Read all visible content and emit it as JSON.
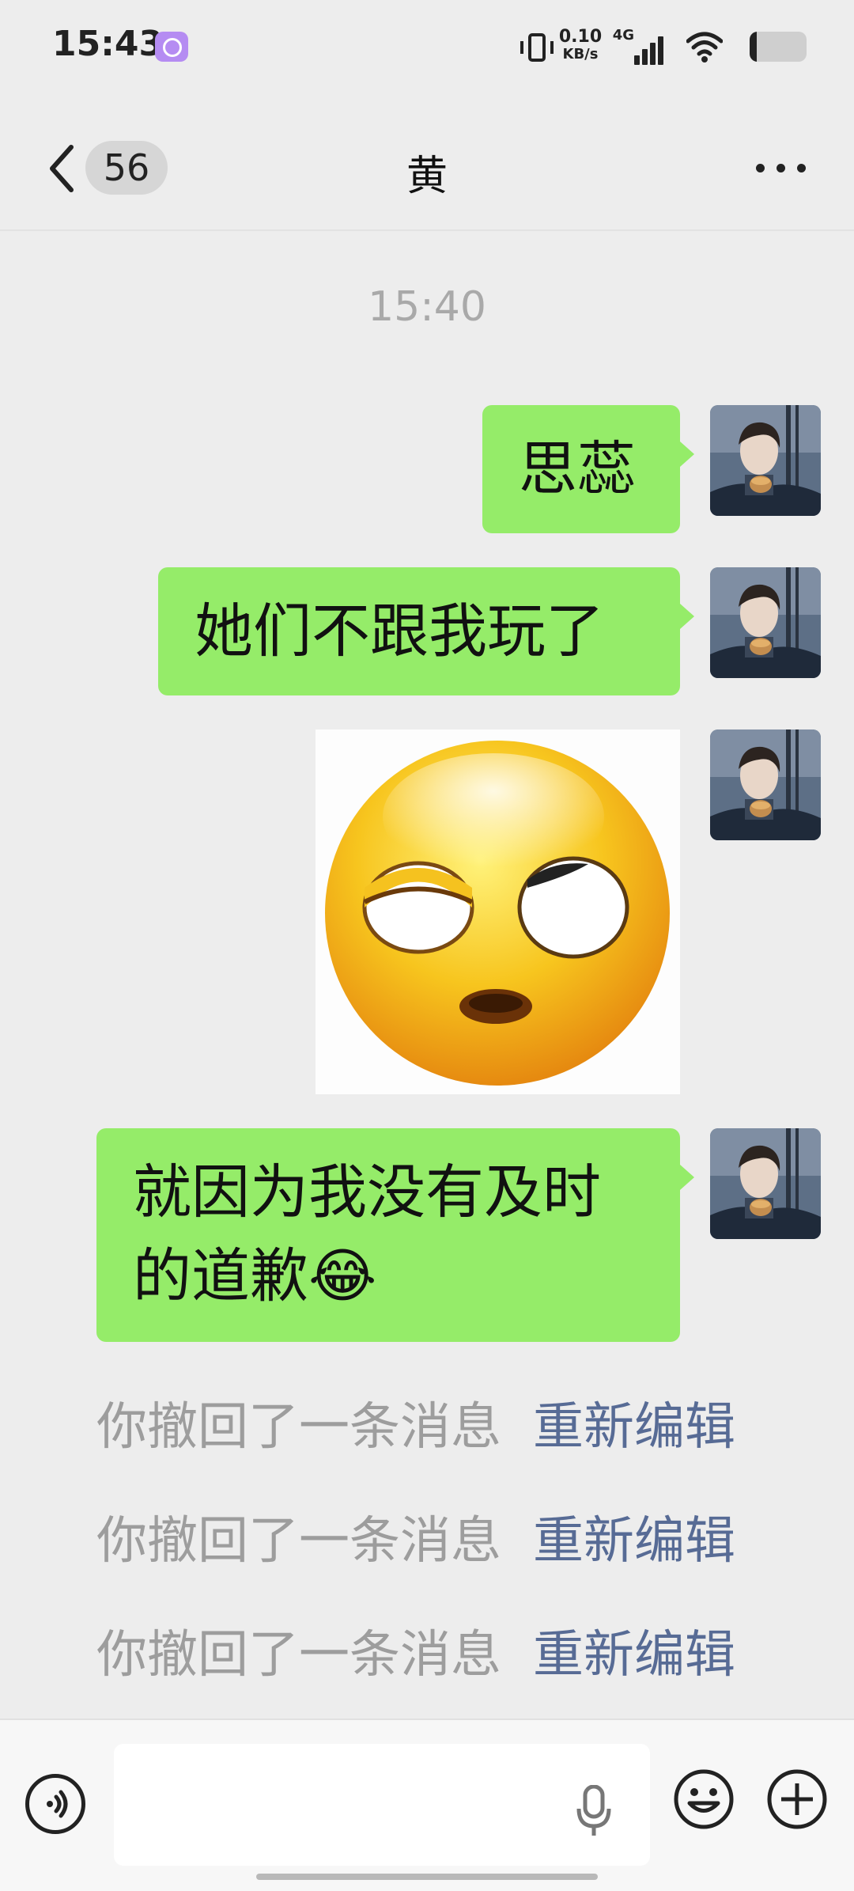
{
  "status_bar": {
    "time": "15:43",
    "net_speed_value": "0.10",
    "net_speed_unit": "KB/s",
    "network_type": "4G",
    "battery_level": 0.12,
    "icons": [
      "app-notification-icon",
      "vibrate-icon",
      "signal-icon",
      "wifi-icon",
      "battery-icon"
    ]
  },
  "nav": {
    "unread_count": "56",
    "title": "黄",
    "icons": [
      "back-icon",
      "more-icon"
    ]
  },
  "chat": {
    "time_divider": "15:40",
    "messages": [
      {
        "type": "text",
        "text": "思蕊"
      },
      {
        "type": "text",
        "text": "她们不跟我玩了"
      },
      {
        "type": "sticker",
        "sticker": "rolling-eye-emoji-sticker"
      },
      {
        "type": "text",
        "line1": "就因为我没有及时",
        "line2": "的道歉😂"
      }
    ],
    "recalls": [
      {
        "text": "你撤回了一条消息",
        "link": "重新编辑"
      },
      {
        "text": "你撤回了一条消息",
        "link": "重新编辑"
      },
      {
        "text": "你撤回了一条消息",
        "link": "重新编辑"
      }
    ]
  },
  "input_bar": {
    "placeholder": "",
    "icons": [
      "voice-icon",
      "mic-icon",
      "emoji-icon",
      "plus-icon"
    ]
  },
  "colors": {
    "background": "#ededed",
    "bubble_green": "#95ec69",
    "link_blue": "#576b95",
    "system_text_grey": "#9d9d9d"
  }
}
